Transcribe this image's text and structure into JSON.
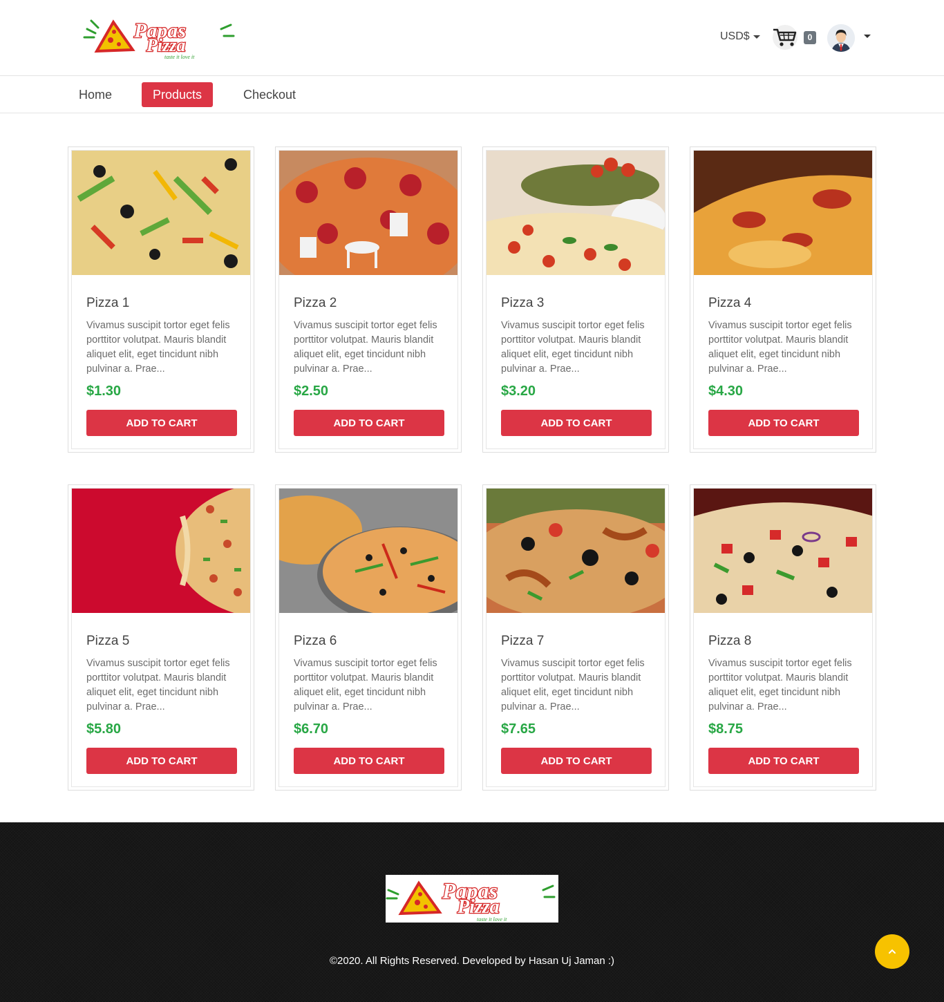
{
  "brand": {
    "logo_alt": "Papa's Pizza",
    "logo_word1": "Papas",
    "logo_word2": "Pizza",
    "tagline": "taste it love it"
  },
  "header": {
    "currency": "USD$",
    "cart_count": "0"
  },
  "nav": {
    "items": [
      {
        "label": "Home",
        "active": false
      },
      {
        "label": "Products",
        "active": true
      },
      {
        "label": "Checkout",
        "active": false
      }
    ]
  },
  "products": [
    {
      "name": "Pizza 1",
      "description": "Vivamus suscipit tortor eget felis porttitor volutpat. Mauris blandit aliquet elit, eget tincidunt nibh pulvinar a. Prae...",
      "price": "$1.30",
      "button": "ADD TO CART"
    },
    {
      "name": "Pizza 2",
      "description": "Vivamus suscipit tortor eget felis porttitor volutpat. Mauris blandit aliquet elit, eget tincidunt nibh pulvinar a. Prae...",
      "price": "$2.50",
      "button": "ADD TO CART"
    },
    {
      "name": "Pizza 3",
      "description": "Vivamus suscipit tortor eget felis porttitor volutpat. Mauris blandit aliquet elit, eget tincidunt nibh pulvinar a. Prae...",
      "price": "$3.20",
      "button": "ADD TO CART"
    },
    {
      "name": "Pizza 4",
      "description": "Vivamus suscipit tortor eget felis porttitor volutpat. Mauris blandit aliquet elit, eget tincidunt nibh pulvinar a. Prae...",
      "price": "$4.30",
      "button": "ADD TO CART"
    },
    {
      "name": "Pizza 5",
      "description": "Vivamus suscipit tortor eget felis porttitor volutpat. Mauris blandit aliquet elit, eget tincidunt nibh pulvinar a. Prae...",
      "price": "$5.80",
      "button": "ADD TO CART"
    },
    {
      "name": "Pizza 6",
      "description": "Vivamus suscipit tortor eget felis porttitor volutpat. Mauris blandit aliquet elit, eget tincidunt nibh pulvinar a. Prae...",
      "price": "$6.70",
      "button": "ADD TO CART"
    },
    {
      "name": "Pizza 7",
      "description": "Vivamus suscipit tortor eget felis porttitor volutpat. Mauris blandit aliquet elit, eget tincidunt nibh pulvinar a. Prae...",
      "price": "$7.65",
      "button": "ADD TO CART"
    },
    {
      "name": "Pizza 8",
      "description": "Vivamus suscipit tortor eget felis porttitor volutpat. Mauris blandit aliquet elit, eget tincidunt nibh pulvinar a. Prae...",
      "price": "$8.75",
      "button": "ADD TO CART"
    }
  ],
  "footer": {
    "copyright": "©2020. All Rights Reserved. Developed by Hasan Uj Jaman :)"
  },
  "icons": {
    "cart": "shopping-cart-icon",
    "avatar": "user-avatar-icon",
    "scroll_top": "chevron-up-icon"
  },
  "colors": {
    "accent": "#dc3545",
    "price": "#28a745",
    "badge": "#6c757d",
    "footer_bg": "#141414",
    "scroll_top": "#f7c200"
  }
}
